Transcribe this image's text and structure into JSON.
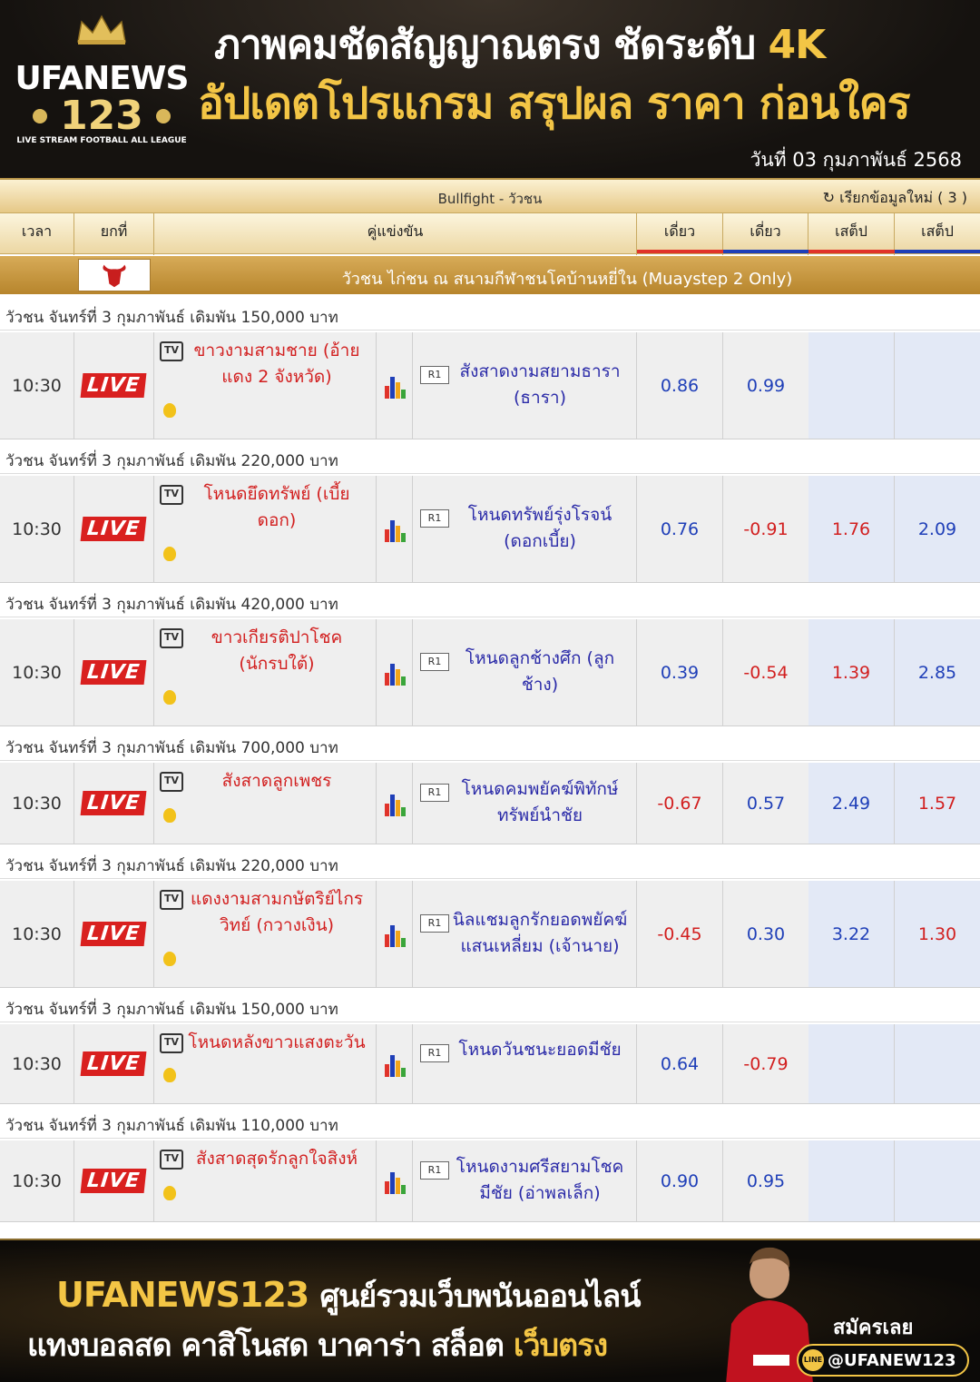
{
  "header": {
    "logo_line1": "UFANEWS",
    "logo_line2": "123",
    "logo_tagline": "LIVE STREAM FOOTBALL ALL LEAGUE",
    "headline1": "ภาพคมชัดสัญญาณตรง ชัดระดับ",
    "headline1_accent": "4K",
    "headline2": "อัปเดตโปรแกรม สรุปผล ราคา ก่อนใคร",
    "date": "วันที่  03 กุมภาพันธ์ 2568"
  },
  "board": {
    "sport_title": "Bullfight - วัวชน",
    "refresh": "เรียกข้อมูลใหม่ ( 3 )",
    "columns": [
      "เวลา",
      "ยกที่",
      "คู่แข่งขัน",
      "เดี่ยว",
      "เดี่ยว",
      "เสต็ป",
      "เสต็ป"
    ],
    "column_bar_colors": [
      "#e0332a",
      "#1f3fb8",
      "#e0332a",
      "#1f3fb8"
    ],
    "league": "วัวชน ไก่ชน ณ สนามกีฬาชนโคบ้านหยี่ใน (Muaystep 2 Only)",
    "live_label": "LIVE",
    "tv_label": "TV",
    "r1_label": "R1",
    "matches": [
      {
        "head": "วัวชน จันทร์ที่ 3 กุมภาพันธ์ เดิมพัน 150,000 บาท",
        "time": "10:30",
        "home": "ขาวงามสามชาย (อ้ายแดง 2 จังหวัด)",
        "away": "สังสาดงามสยามธารา (ธารา)",
        "odds": [
          "0.86",
          "0.99",
          "",
          ""
        ],
        "odds_colors": [
          "blue",
          "blue",
          "",
          ""
        ]
      },
      {
        "head": "วัวชน จันทร์ที่ 3 กุมภาพันธ์ เดิมพัน 220,000 บาท",
        "time": "10:30",
        "home": "โหนดยึดทรัพย์ (เบี้ยดอก)",
        "away": "โหนดทรัพย์รุ่งโรจน์ (ดอกเบี้ย)",
        "odds": [
          "0.76",
          "-0.91",
          "1.76",
          "2.09"
        ],
        "odds_colors": [
          "blue",
          "red",
          "red",
          "blue"
        ]
      },
      {
        "head": "วัวชน จันทร์ที่ 3 กุมภาพันธ์ เดิมพัน 420,000 บาท",
        "time": "10:30",
        "home": "ขาวเกียรติปาโชค (นักรบใต้)",
        "away": "โหนดลูกช้างศึก (ลูกช้าง)",
        "odds": [
          "0.39",
          "-0.54",
          "1.39",
          "2.85"
        ],
        "odds_colors": [
          "blue",
          "red",
          "red",
          "blue"
        ]
      },
      {
        "head": "วัวชน จันทร์ที่ 3 กุมภาพันธ์ เดิมพัน 700,000 บาท",
        "time": "10:30",
        "home": "สังสาดลูกเพชร",
        "away": "โหนดคมพยัคฆ์พิทักษ์ทรัพย์นำชัย",
        "odds": [
          "-0.67",
          "0.57",
          "2.49",
          "1.57"
        ],
        "odds_colors": [
          "red",
          "blue",
          "blue",
          "red"
        ]
      },
      {
        "head": "วัวชน จันทร์ที่ 3 กุมภาพันธ์ เดิมพัน 220,000 บาท",
        "time": "10:30",
        "home": "แดงงามสามกษัตริย์ไกรวิทย์ (กวางเงิน)",
        "away": "นิลแชมลูกรักยอดพยัคฆ์แสนเหลี่ยม (เจ้านาย)",
        "odds": [
          "-0.45",
          "0.30",
          "3.22",
          "1.30"
        ],
        "odds_colors": [
          "red",
          "blue",
          "blue",
          "red"
        ]
      },
      {
        "head": "วัวชน จันทร์ที่ 3 กุมภาพันธ์ เดิมพัน 150,000 บาท",
        "time": "10:30",
        "home": "โหนดหลังขาวแสงตะวัน",
        "away": "โหนดวันชนะยอดมีชัย",
        "odds": [
          "0.64",
          "-0.79",
          "",
          ""
        ],
        "odds_colors": [
          "blue",
          "red",
          "",
          ""
        ]
      },
      {
        "head": "วัวชน จันทร์ที่ 3 กุมภาพันธ์ เดิมพัน 110,000 บาท",
        "time": "10:30",
        "home": "สังสาดสุดรักลูกใจสิงห์",
        "away": "โหนดงามศรีสยามโชคมีชัย (อ่าพลเล็ก)",
        "odds": [
          "0.90",
          "0.95",
          "",
          ""
        ],
        "odds_colors": [
          "blue",
          "blue",
          "",
          ""
        ]
      }
    ]
  },
  "footer": {
    "brand": "UFANEWS123",
    "brand_tagline": "ศูนย์รวมเว็บพนันออนไลน์",
    "line2": "แทงบอลสด คาสิโนสด บาคาร่า สล็อต",
    "line2_accent": "เว็บตรง",
    "signup": "สมัครเลย",
    "line_handle": "@UFANEW123"
  }
}
